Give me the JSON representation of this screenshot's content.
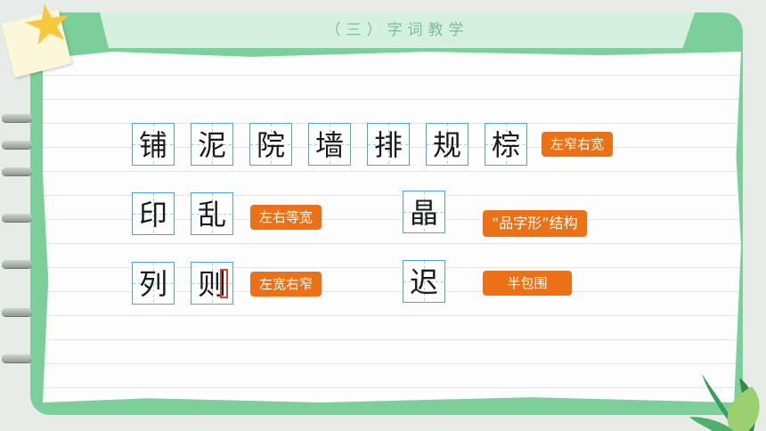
{
  "title": "（三）字词教学",
  "rows": [
    {
      "chars": [
        "铺",
        "泥",
        "院",
        "墙",
        "排",
        "规",
        "棕"
      ],
      "label": "左窄右宽"
    },
    {
      "chars": [
        "印",
        "乱"
      ],
      "label": "左右等宽",
      "extra_char": "晶",
      "extra_label": "“品字形”结构"
    },
    {
      "chars": [
        "列",
        "则"
      ],
      "label": "左宽右窄",
      "extra_char": "迟",
      "extra_label": "半包围"
    }
  ],
  "colors": {
    "frame_green": "#7ccf98",
    "label_orange": "#ec7116",
    "grid_blue": "#4aa7d6",
    "title_green": "#7abf96",
    "highlight_red": "#d4433a"
  },
  "icons": [
    "star-icon",
    "leaf-icon"
  ]
}
